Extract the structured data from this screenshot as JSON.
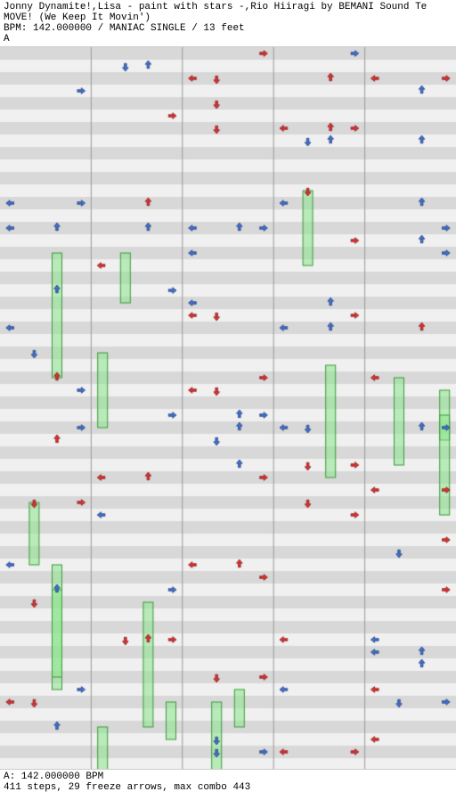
{
  "header": {
    "title": "Jonny Dynamite!,Lisa - paint with stars -,Rio Hiiragi by BEMANI Sound Te",
    "subtitle": "MOVE! (We Keep It Movin')",
    "bpm_line": "BPM: 142.000000 / MANIAC SINGLE / 13 feet",
    "left_label": "A"
  },
  "footer": {
    "bpm_note": "A: 142.000000 BPM",
    "stats": "411 steps, 29 freeze arrows, max combo 443"
  },
  "colors": {
    "background_even": "#d8d8d8",
    "background_odd": "#f0f0f0",
    "arrow_red": "#e03030",
    "arrow_blue": "#4070d0",
    "arrow_pink": "#d050b0",
    "arrow_green": "#20a020",
    "freeze_fill": "#90e890",
    "freeze_border": "#30a030"
  }
}
